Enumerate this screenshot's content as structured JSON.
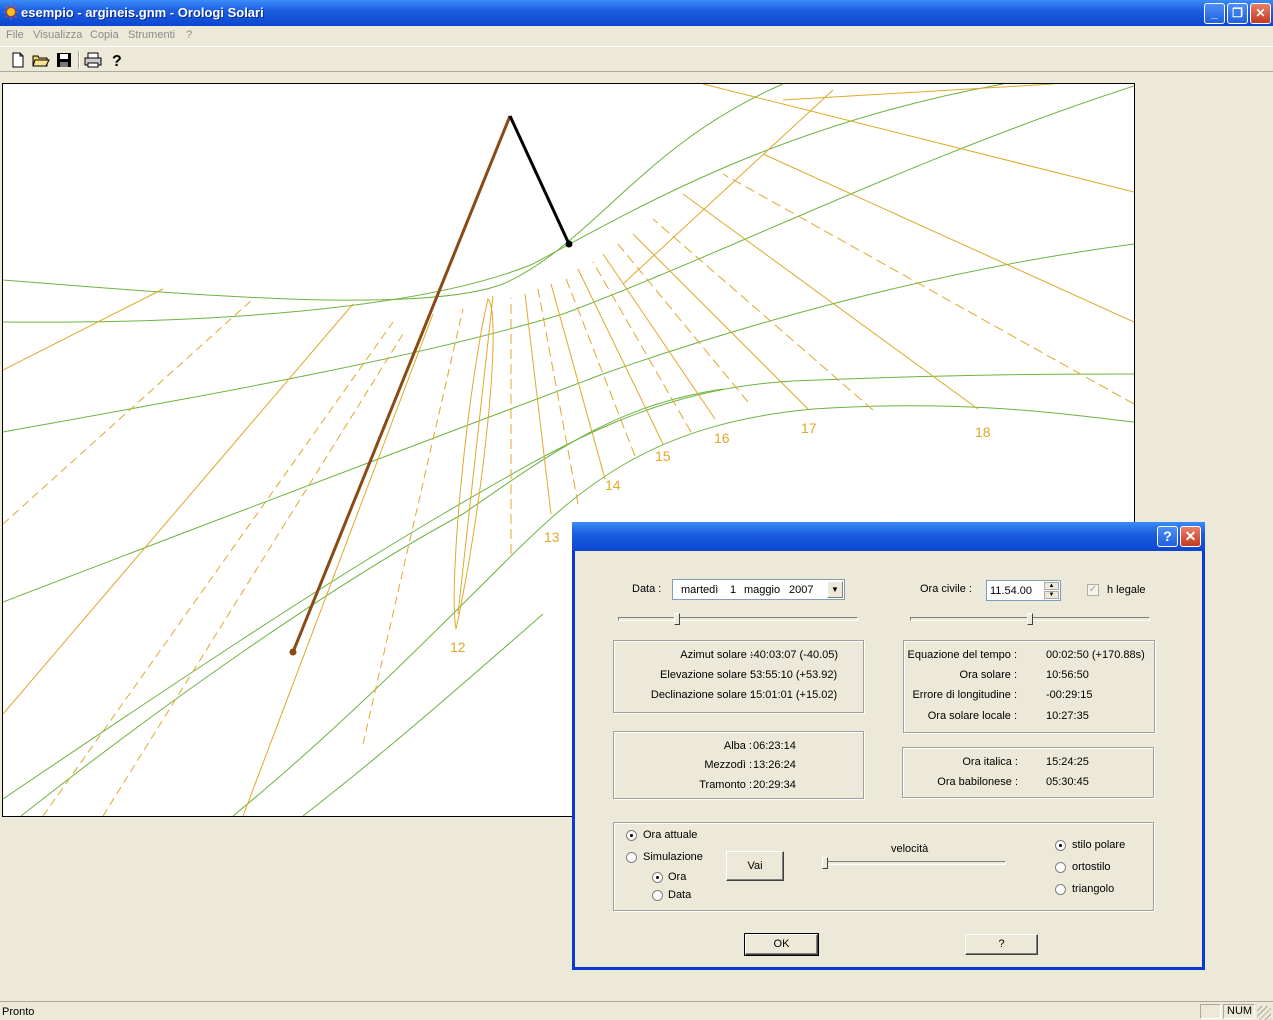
{
  "window": {
    "title": "esempio - argineis.gnm - Orologi Solari",
    "minimize": "_",
    "restore": "❐",
    "close": "✕"
  },
  "menu": [
    "File",
    "Visualizza",
    "Copia",
    "Strumenti",
    "?"
  ],
  "toolbar": [
    {
      "name": "new-file-icon",
      "glyph": "🗋"
    },
    {
      "name": "open-folder-icon",
      "glyph": "📂"
    },
    {
      "name": "save-icon",
      "glyph": "💾"
    },
    {
      "name": "print-icon",
      "glyph": "🖶"
    },
    {
      "name": "help-cursor-icon",
      "glyph": "?"
    }
  ],
  "sundial": {
    "hour_labels": [
      "12",
      "13",
      "14",
      "15",
      "16",
      "17",
      "18"
    ],
    "colors": {
      "declination_lines": "#6db33f",
      "hour_lines": "#e0a82a",
      "polar_style": "#8b4a14",
      "ortho_style": "#000000"
    }
  },
  "dialog": {
    "help": "?",
    "close": "✕",
    "date_label": "Data :",
    "date_weekday": "martedì",
    "date_day": "1",
    "date_month": "maggio",
    "date_year": "2007",
    "time_label": "Ora civile :",
    "time_value": "11.54.00",
    "dst_label": "h legale",
    "date_slider": 0.24,
    "time_slider": 0.5,
    "solar": {
      "azimut_label": "Azimut solare :",
      "azimut_value": "-40:03:07 (-40.05)",
      "elevazione_label": "Elevazione solare :",
      "elevazione_value": "53:55:10 (+53.92)",
      "declinazione_label": "Declinazione solare :",
      "declinazione_value": "15:01:01 (+15.02)"
    },
    "time_info": {
      "eq_label": "Equazione del tempo :",
      "eq_value": "00:02:50 (+170.88s)",
      "ora_solare_label": "Ora solare :",
      "ora_solare_value": "10:56:50",
      "errore_label": "Errore di longitudine :",
      "errore_value": "-00:29:15",
      "ora_locale_label": "Ora solare locale :",
      "ora_locale_value": "10:27:35"
    },
    "day": {
      "alba_label": "Alba :",
      "alba_value": "06:23:14",
      "mezzodi_label": "Mezzodì :",
      "mezzodi_value": "13:26:24",
      "tramonto_label": "Tramonto :",
      "tramonto_value": "20:29:34"
    },
    "hours": {
      "italica_label": "Ora italica :",
      "italica_value": "15:24:25",
      "babilonese_label": "Ora babilonese :",
      "babilonese_value": "05:30:45"
    },
    "mode": {
      "attuale": "Ora attuale",
      "simulazione": "Simulazione",
      "ora": "Ora",
      "data": "Data",
      "vai": "Vai",
      "velocita": "velocità",
      "velocita_level": 0.0,
      "stilo_polare": "stilo polare",
      "ortostilo": "ortostilo",
      "triangolo": "triangolo"
    },
    "ok": "OK",
    "help_button": "?"
  },
  "status": {
    "text": "Pronto",
    "num": "NUM"
  }
}
